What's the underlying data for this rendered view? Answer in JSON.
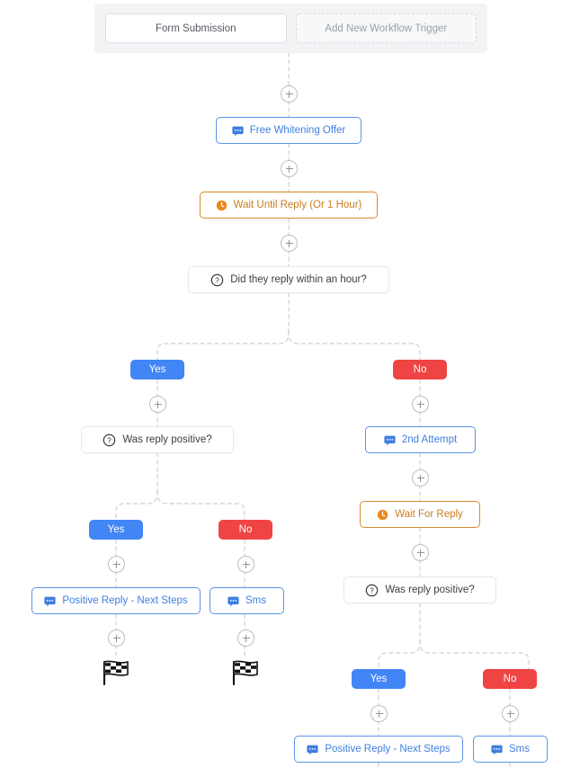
{
  "header": {
    "active_trigger_label": "Form Submission",
    "add_trigger_label": "Add New Workflow Trigger"
  },
  "colors": {
    "sms_border": "#5b93e8",
    "sms_text": "#3f7fe0",
    "wait_border": "#d98b2b",
    "wait_text": "#c97d20",
    "yes_badge": "#4285f4",
    "no_badge": "#ef4444",
    "connector": "#d3d6db",
    "panel_bg": "#f2f3f5"
  },
  "nodes": {
    "free_whitening_offer": {
      "label": "Free Whitening Offer",
      "icon": "sms-icon",
      "type": "sms"
    },
    "wait_until_reply": {
      "label": "Wait Until Reply (Or 1 Hour)",
      "icon": "clock-icon",
      "type": "wait"
    },
    "replied_within_hour": {
      "label": "Did they reply within an hour?",
      "icon": "question-icon",
      "type": "condition"
    },
    "left_was_reply_positive": {
      "label": "Was reply positive?",
      "icon": "question-icon",
      "type": "condition"
    },
    "left_positive_reply": {
      "label": "Positive Reply - Next Steps",
      "icon": "sms-icon",
      "type": "sms"
    },
    "left_sms": {
      "label": "Sms",
      "icon": "sms-icon",
      "type": "sms"
    },
    "second_attempt": {
      "label": "2nd Attempt",
      "icon": "sms-icon",
      "type": "sms"
    },
    "wait_for_reply": {
      "label": "Wait For Reply",
      "icon": "clock-icon",
      "type": "wait"
    },
    "right_was_reply_positive": {
      "label": "Was reply positive?",
      "icon": "question-icon",
      "type": "condition"
    },
    "right_positive_reply": {
      "label": "Positive Reply - Next Steps",
      "icon": "sms-icon",
      "type": "sms"
    },
    "right_sms": {
      "label": "Sms",
      "icon": "sms-icon",
      "type": "sms"
    }
  },
  "branches": {
    "root_yes": "Yes",
    "root_no": "No",
    "left_yes": "Yes",
    "left_no": "No",
    "right_yes": "Yes",
    "right_no": "No"
  },
  "end_markers": {
    "left_positive_end": "checkered-flag-icon",
    "left_sms_end": "checkered-flag-icon"
  }
}
